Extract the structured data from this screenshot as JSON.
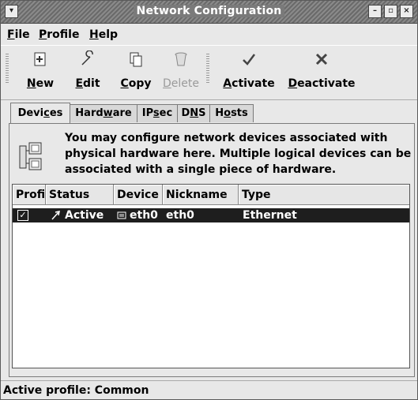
{
  "window": {
    "title": "Network Configuration"
  },
  "title_buttons": {
    "menu": "▾",
    "minimize": "–",
    "maximize": "▫",
    "close": "×"
  },
  "menubar": {
    "file": {
      "u": "F",
      "rest": "ile"
    },
    "profile": {
      "u": "P",
      "rest": "rofile"
    },
    "help": {
      "u": "H",
      "rest": "elp"
    }
  },
  "toolbar": {
    "new": {
      "u": "N",
      "rest": "ew",
      "icon": "new-icon"
    },
    "edit": {
      "u": "E",
      "rest": "dit",
      "icon": "wrench-icon"
    },
    "copy": {
      "u": "C",
      "rest": "opy",
      "icon": "copy-icon"
    },
    "delete": {
      "pre": "",
      "u": "D",
      "rest": "elete",
      "icon": "trash-icon"
    },
    "activate": {
      "u": "A",
      "rest": "ctivate",
      "icon": "check-icon"
    },
    "deactivate": {
      "u": "D",
      "rest": "eactivate",
      "icon": "x-icon"
    }
  },
  "tabs": [
    {
      "pre": "Devi",
      "u": "c",
      "rest": "es"
    },
    {
      "pre": "Hard",
      "u": "w",
      "rest": "are"
    },
    {
      "pre": "IP",
      "u": "s",
      "rest": "ec"
    },
    {
      "pre": "D",
      "u": "N",
      "rest": "S"
    },
    {
      "pre": "H",
      "u": "o",
      "rest": "sts"
    }
  ],
  "info": {
    "line1": "You may configure network devices associated with",
    "line2": "physical hardware here.  Multiple logical devices can be",
    "line3": "associated with a single piece of hardware."
  },
  "columns": [
    "Profi",
    "Status",
    "Device",
    "Nickname",
    "Type"
  ],
  "rows": [
    {
      "profile_checked": "✓",
      "status": "Active",
      "device": "eth0",
      "nickname": "eth0",
      "type": "Ethernet"
    }
  ],
  "statusbar": "Active profile: Common"
}
